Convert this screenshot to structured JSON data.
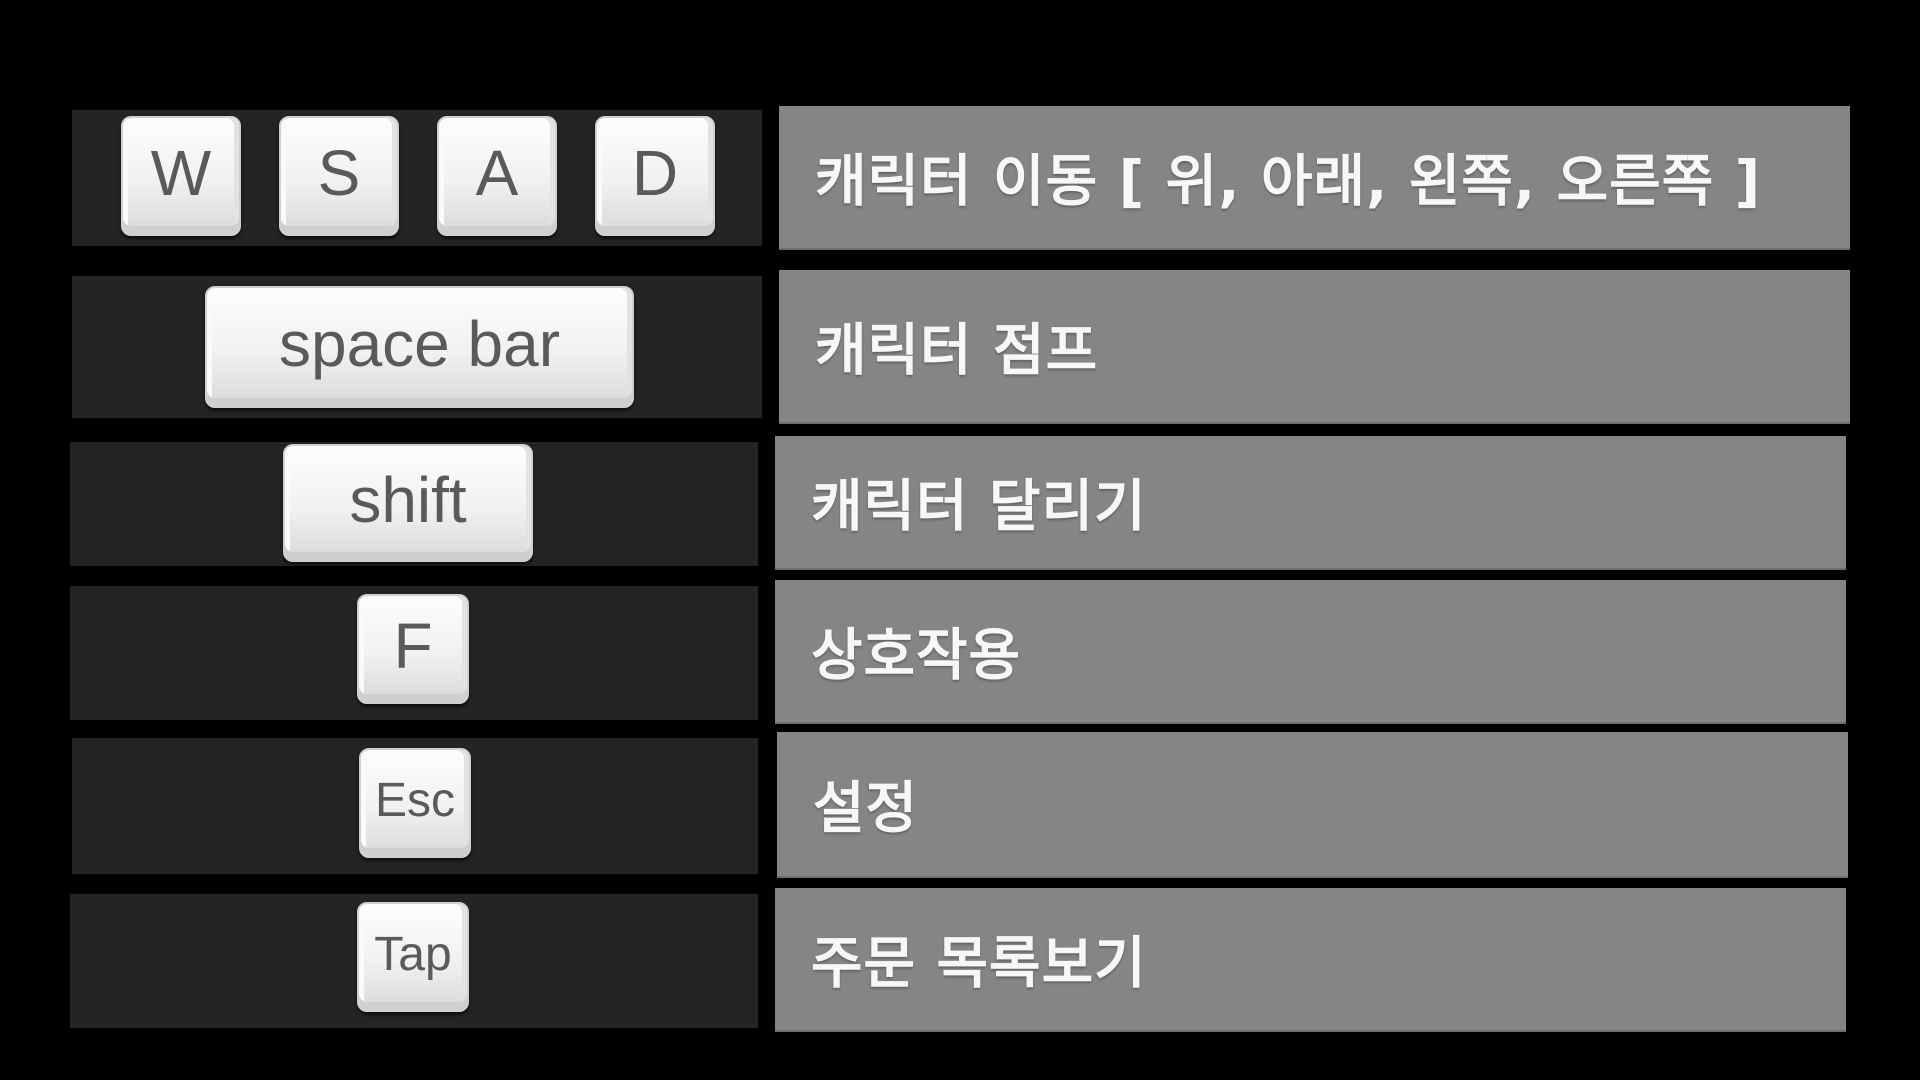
{
  "rows": [
    {
      "keys": [
        "W",
        "S",
        "A",
        "D"
      ],
      "description": "캐릭터 이동 [ 위, 아래, 왼쪽, 오른쪽 ]"
    },
    {
      "keys": [
        "space bar"
      ],
      "description": "캐릭터 점프"
    },
    {
      "keys": [
        "shift"
      ],
      "description": "캐릭터 달리기"
    },
    {
      "keys": [
        "F"
      ],
      "description": "상호작용"
    },
    {
      "keys": [
        "Esc"
      ],
      "description": "설정"
    },
    {
      "keys": [
        "Tap"
      ],
      "description": "주문 목록보기"
    }
  ],
  "colors": {
    "background": "#000000",
    "key_panel": "#242424",
    "description_panel": "#858585",
    "description_text": "#f7f7f7",
    "key_cap": "#f4f4f4",
    "key_label": "#5a5a5a"
  }
}
